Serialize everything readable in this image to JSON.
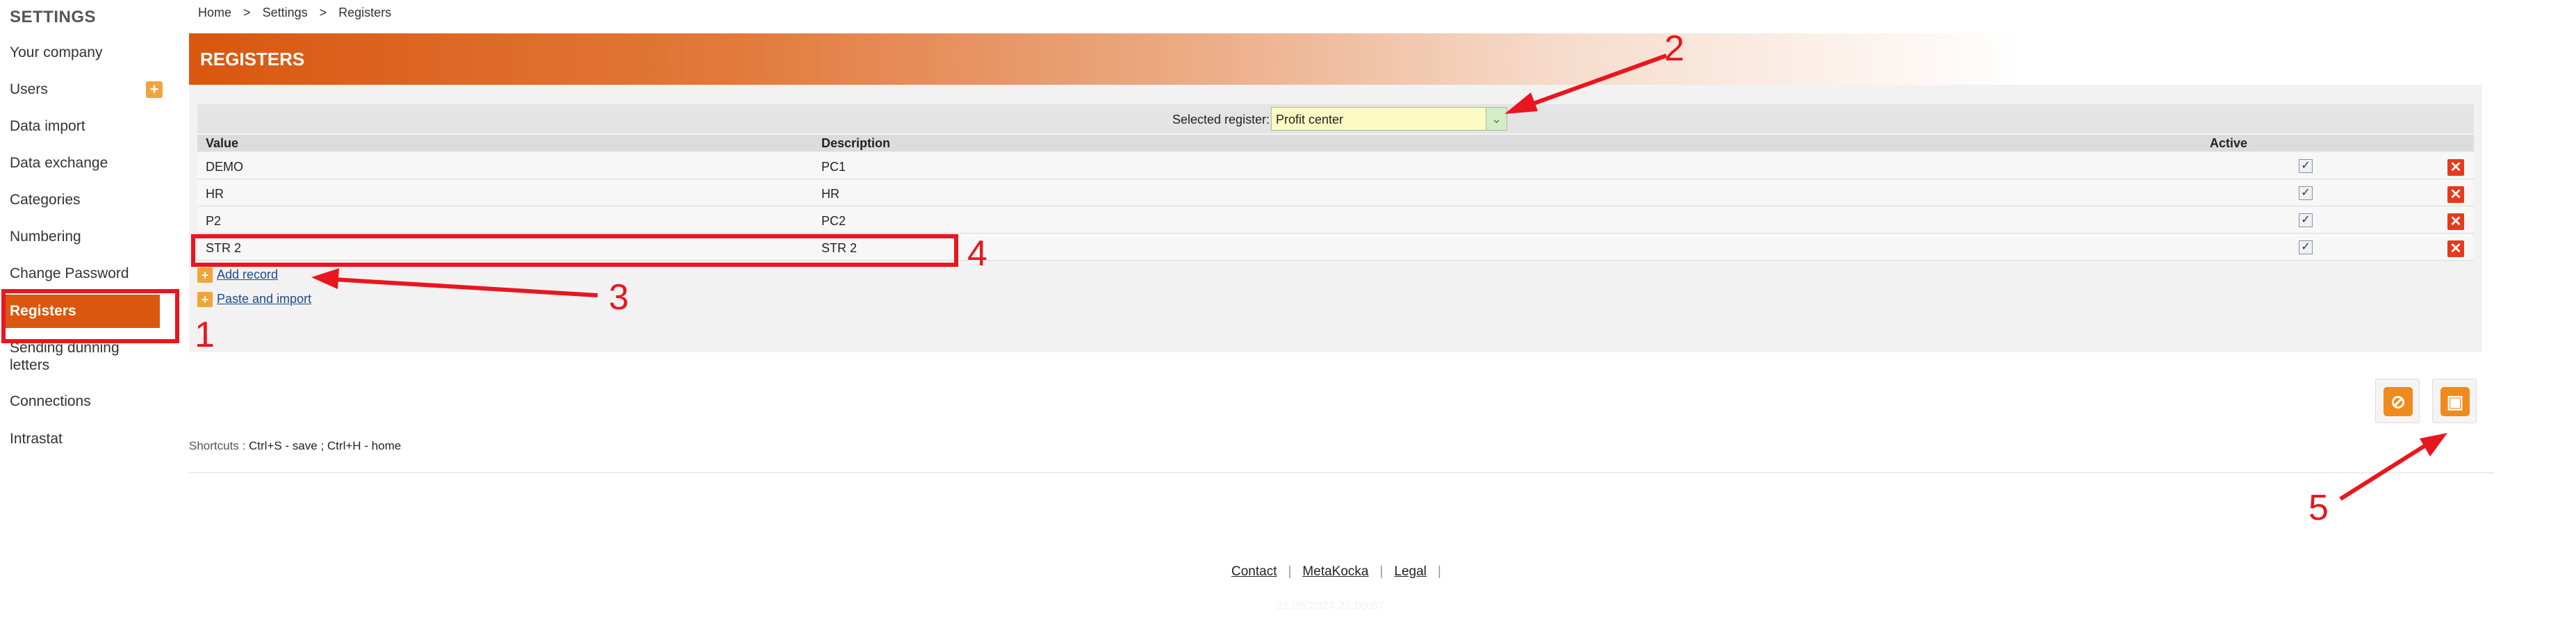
{
  "sidebar": {
    "title": "SETTINGS",
    "items": [
      {
        "label": "Your company"
      },
      {
        "label": "Users"
      },
      {
        "label": "Data import"
      },
      {
        "label": "Data exchange"
      },
      {
        "label": "Categories"
      },
      {
        "label": "Numbering"
      },
      {
        "label": "Change Password"
      },
      {
        "label": "Registers"
      },
      {
        "label": "Sending dunning letters"
      },
      {
        "label": "Connections"
      },
      {
        "label": "Intrastat"
      }
    ],
    "active": "Registers"
  },
  "breadcrumb": {
    "home": "Home",
    "sep1": ">",
    "settings": "Settings",
    "sep2": ">",
    "current": "Registers"
  },
  "header": {
    "title": "REGISTERS"
  },
  "selector": {
    "label": "Selected register:",
    "value": "Profit center"
  },
  "table": {
    "columns": [
      "Value",
      "Description",
      "Active"
    ],
    "rows": [
      {
        "value": "DEMO",
        "description": "PC1",
        "active": true
      },
      {
        "value": "HR",
        "description": "HR",
        "active": true
      },
      {
        "value": "P2",
        "description": "PC2",
        "active": true
      },
      {
        "value": "STR 2",
        "description": "STR 2",
        "active": true
      }
    ]
  },
  "actions": {
    "add_record": "Add record",
    "paste_import": "Paste and import"
  },
  "shortcuts": {
    "label": "Shortcuts :",
    "save": "Ctrl+S - save ;",
    "home": "Ctrl+H - home"
  },
  "footer": {
    "contact": "Contact",
    "metakocka": "MetaKocka",
    "legal": "Legal",
    "sep": "|",
    "timestamp": "31.05.2024 22:00:07"
  },
  "annotations": {
    "n1": "1",
    "n2": "2",
    "n3": "3",
    "n4": "4",
    "n5": "5"
  },
  "colors": {
    "accent": "#d9570f",
    "annotation": "#e8161f",
    "delete": "#e53a1e",
    "plus": "#f2a43c"
  }
}
